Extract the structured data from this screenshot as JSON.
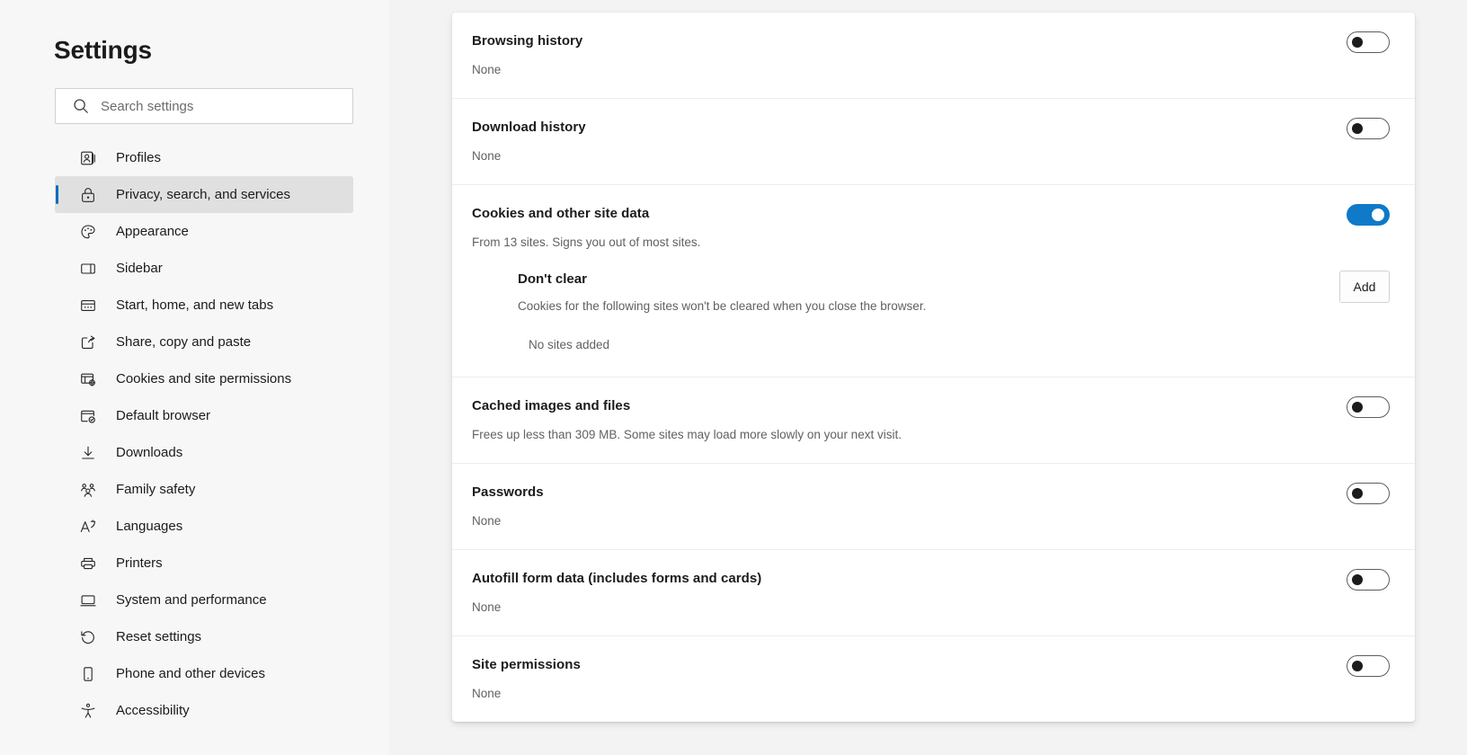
{
  "sidebar": {
    "title": "Settings",
    "search": {
      "placeholder": "Search settings",
      "value": "",
      "icon": "search-icon"
    },
    "items": [
      {
        "label": "Profiles",
        "icon": "profile-icon",
        "active": false
      },
      {
        "label": "Privacy, search, and services",
        "icon": "lock-icon",
        "active": true
      },
      {
        "label": "Appearance",
        "icon": "palette-icon",
        "active": false
      },
      {
        "label": "Sidebar",
        "icon": "sidebar-icon",
        "active": false
      },
      {
        "label": "Start, home, and new tabs",
        "icon": "new-tab-icon",
        "active": false
      },
      {
        "label": "Share, copy and paste",
        "icon": "share-icon",
        "active": false
      },
      {
        "label": "Cookies and site permissions",
        "icon": "cookie-settings-icon",
        "active": false
      },
      {
        "label": "Default browser",
        "icon": "default-browser-icon",
        "active": false
      },
      {
        "label": "Downloads",
        "icon": "download-icon",
        "active": false
      },
      {
        "label": "Family safety",
        "icon": "family-icon",
        "active": false
      },
      {
        "label": "Languages",
        "icon": "languages-icon",
        "active": false
      },
      {
        "label": "Printers",
        "icon": "printer-icon",
        "active": false
      },
      {
        "label": "System and performance",
        "icon": "monitor-icon",
        "active": false
      },
      {
        "label": "Reset settings",
        "icon": "reset-icon",
        "active": false
      },
      {
        "label": "Phone and other devices",
        "icon": "phone-icon",
        "active": false
      },
      {
        "label": "Accessibility",
        "icon": "accessibility-icon",
        "active": false
      }
    ]
  },
  "colors": {
    "accent": "#0f6cbd",
    "toggle_on": "#0f7ac8",
    "content_background": "#f3f3f3",
    "sidebar_background": "#f7f7f7",
    "card_background": "#ffffff",
    "active_item_background": "#e0e0e0",
    "subtext": "#616161"
  },
  "main": {
    "rows": [
      {
        "title": "Browsing history",
        "subtitle": "None",
        "toggle_state": "off"
      },
      {
        "title": "Download history",
        "subtitle": "None",
        "toggle_state": "off"
      },
      {
        "title": "Cookies and other site data",
        "subtitle": "From 13 sites. Signs you out of most sites.",
        "toggle_state": "on",
        "subsection": {
          "title": "Don't clear",
          "description": "Cookies for the following sites won't be cleared when you close the browser.",
          "empty_text": "No sites added",
          "add_label": "Add"
        }
      },
      {
        "title": "Cached images and files",
        "subtitle": "Frees up less than 309 MB. Some sites may load more slowly on your next visit.",
        "toggle_state": "off"
      },
      {
        "title": "Passwords",
        "subtitle": "None",
        "toggle_state": "off"
      },
      {
        "title": "Autofill form data (includes forms and cards)",
        "subtitle": "None",
        "toggle_state": "off"
      },
      {
        "title": "Site permissions",
        "subtitle": "None",
        "toggle_state": "off"
      }
    ]
  }
}
